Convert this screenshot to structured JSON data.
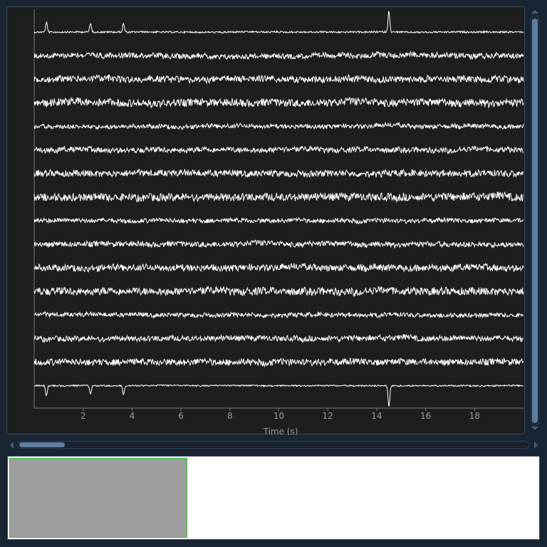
{
  "plot": {
    "xlabel": "Time (s)",
    "x_ticks": [
      "2",
      "4",
      "6",
      "8",
      "10",
      "12",
      "14",
      "16",
      "18"
    ],
    "channel_count": 16
  },
  "chart_data": {
    "type": "line",
    "title": "",
    "xlabel": "Time (s)",
    "ylabel": "",
    "xlim": [
      0,
      20
    ],
    "x_ticks": [
      2,
      4,
      6,
      8,
      10,
      12,
      14,
      16,
      18
    ],
    "grid": false,
    "series_count": 16,
    "events": [
      0.5,
      2.3,
      3.65,
      14.5
    ]
  },
  "colors": {
    "background": "#1a2533",
    "plot_bg": "#1e1e1e",
    "trace": "#ffffff",
    "axis_text": "#9a9a9a",
    "scroll_thumb": "#5f7f9e",
    "overview_window": "#9e9e9e",
    "overview_border": "#22cc22"
  },
  "icons": {
    "scroll_up": "triangle-up",
    "scroll_down": "triangle-down",
    "scroll_left": "triangle-left",
    "scroll_right": "triangle-right"
  }
}
